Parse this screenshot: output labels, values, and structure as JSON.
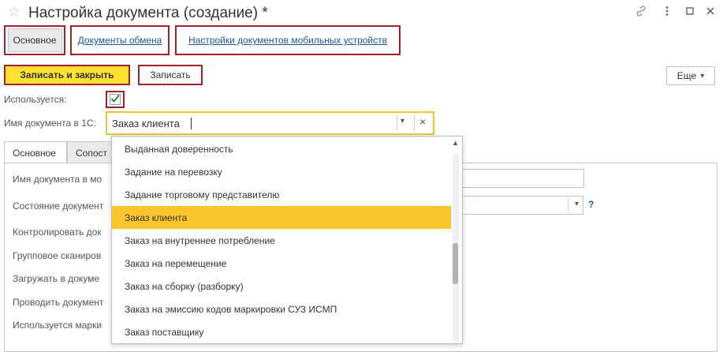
{
  "window": {
    "title": "Настройка документа (создание) *",
    "star_icon": "☆",
    "link_icon": "🔗",
    "more_icon": "⋮",
    "maximize_icon": "☐",
    "close_icon": "✕"
  },
  "nav": {
    "main": "Основное",
    "exchange_docs": "Документы обмена",
    "mobile_settings": "Настройки документов мобильных устройств"
  },
  "toolbar": {
    "save_close": "Записать и закрыть",
    "save": "Записать",
    "more": "Еще",
    "more_arrow": "▾"
  },
  "form": {
    "used_label": "Используется:",
    "used_checked": true,
    "doc_name_label": "Имя документа в 1С:",
    "doc_name_value": "Заказ клиента",
    "dropdown_arrow": "▾",
    "clear_icon": "×"
  },
  "tabs": {
    "main": "Основное",
    "mapping_partial": "Сопост"
  },
  "panel": {
    "rows": [
      "Имя документа в мо",
      "Состояние документ",
      "Контролировать док",
      "Групповое сканиров",
      "Загружать в докуме",
      "Проводить документ",
      "Используется марки"
    ],
    "help": "?",
    "select_arrow": "▾"
  },
  "dropdown": {
    "scroll_up": "▲",
    "selected_index": 3,
    "items": [
      "Выданная доверенность",
      "Задание на перевозку",
      "Задание торговому представителю",
      "Заказ клиента",
      "Заказ на внутреннее потребление",
      "Заказ на перемещение",
      "Заказ на сборку (разборку)",
      "Заказ на эмиссию кодов маркировки СУЗ ИСМП",
      "Заказ поставщику"
    ]
  },
  "colors": {
    "accent_border": "#a4212b",
    "primary_button": "#fbe130",
    "selected_item": "#f9c72c",
    "link": "#1e58a4",
    "check": "#2e8b3a"
  }
}
